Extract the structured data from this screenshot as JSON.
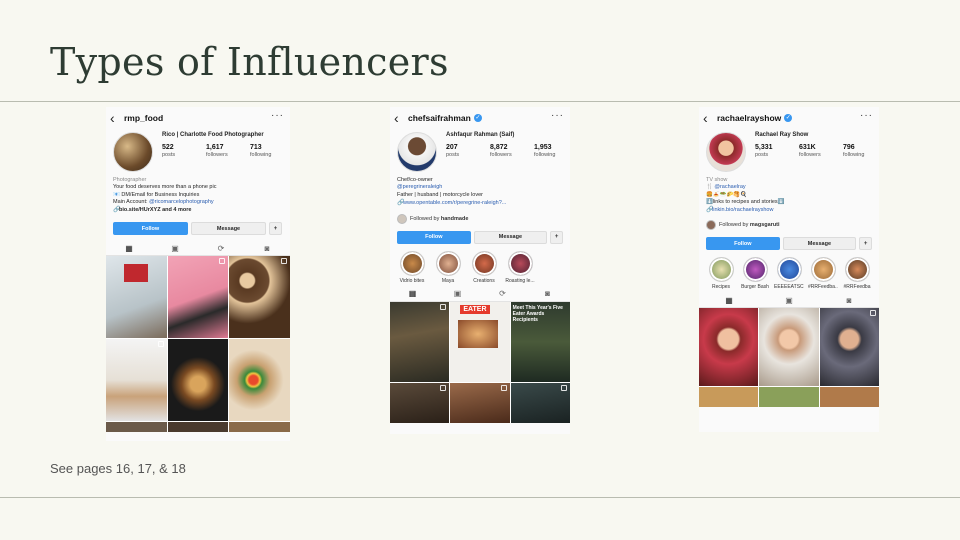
{
  "slide": {
    "title": "Types of Influencers",
    "caption": "See pages 16, 17, & 18"
  },
  "profiles": [
    {
      "username": "rmp_food",
      "verified": false,
      "display_name": "Rico | Charlotte Food Photographer",
      "stats": [
        {
          "value": "522",
          "label": "posts"
        },
        {
          "value": "1,617",
          "label": "followers"
        },
        {
          "value": "713",
          "label": "following"
        }
      ],
      "bio": {
        "category": "Photographer",
        "line1": "Your food deserves more than a phone pic",
        "line2": "📧 DM/Email for Business Inquiries",
        "line3_prefix": "Main Account: ",
        "line3_link": "@ricomarcelophotography",
        "link": "bio.site/HUrXYZ and 4 more"
      },
      "buttons": {
        "follow": "Follow",
        "message": "Message"
      }
    },
    {
      "username": "chefsaifrahman",
      "verified": true,
      "display_name": "Ashfaqur Rahman (Saif)",
      "stats": [
        {
          "value": "207",
          "label": "posts"
        },
        {
          "value": "8,872",
          "label": "followers"
        },
        {
          "value": "1,953",
          "label": "following"
        }
      ],
      "bio": {
        "line1": "Chef/co-owner",
        "line2": "@peregrineraleigh",
        "line3": "Father | husband | motorcycle lover",
        "link": "www.opentable.com/r/peregrine-raleigh?..."
      },
      "followed_by_prefix": "Followed by ",
      "followed_by": "handmade",
      "buttons": {
        "follow": "Follow",
        "message": "Message"
      },
      "highlights": [
        "Vidrio bites",
        "Maya",
        "Creations",
        "Roasting le..."
      ],
      "post_text": {
        "eater": "EATER",
        "headline": "Meet This Year's Five Eater Awards Recipients"
      }
    },
    {
      "username": "rachaelrayshow",
      "verified": true,
      "display_name": "Rachael Ray Show",
      "stats": [
        {
          "value": "5,331",
          "label": "posts"
        },
        {
          "value": "631K",
          "label": "followers"
        },
        {
          "value": "796",
          "label": "following"
        }
      ],
      "bio": {
        "category": "TV show",
        "line1": "🍴 @rachaelray",
        "line2": "🍔🍝🥗🌮🥞🍳",
        "line3": "⬇️links to recipes and stories⬇️",
        "link": "linkin.bio/rachaelrayshow"
      },
      "followed_by_prefix": "Followed by ",
      "followed_by": "magsgaruti",
      "buttons": {
        "follow": "Follow",
        "message": "Message"
      },
      "highlights": [
        "Recipes",
        "Burger Bash",
        "EEEEEATSC...",
        "#RRFeedba...",
        "#RRFeedba"
      ]
    }
  ],
  "colors": {
    "slide_bg": "#f8f8f1",
    "title": "#2e3c33",
    "instagram_blue": "#3897f0"
  },
  "icons": [
    "back-arrow-icon",
    "more-icon",
    "verified-icon",
    "link-icon",
    "add-person-icon",
    "grid-icon",
    "reels-icon",
    "igtv-icon",
    "tagged-icon"
  ]
}
